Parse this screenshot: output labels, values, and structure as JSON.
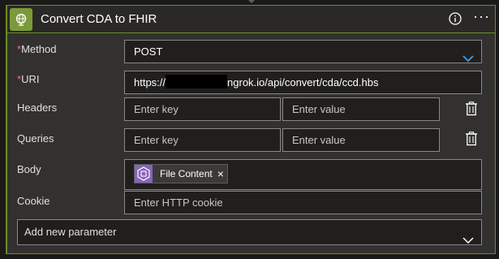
{
  "header": {
    "title": "Convert CDA to FHIR",
    "icon": "globe-icon",
    "info_icon": "info-icon",
    "more_label": "···"
  },
  "fields": {
    "method": {
      "label": "Method",
      "required_mark": "*",
      "value": "POST"
    },
    "uri": {
      "label": "URI",
      "required_mark": "*",
      "value_prefix": "https://",
      "value_suffix": "ngrok.io/api/convert/cda/ccd.hbs"
    },
    "headers": {
      "label": "Headers",
      "key_placeholder": "Enter key",
      "value_placeholder": "Enter value"
    },
    "queries": {
      "label": "Queries",
      "key_placeholder": "Enter key",
      "value_placeholder": "Enter value"
    },
    "body": {
      "label": "Body",
      "token_label": "File Content",
      "token_close": "×"
    },
    "cookie": {
      "label": "Cookie",
      "placeholder": "Enter HTTP cookie"
    }
  },
  "add_parameter": {
    "label": "Add new parameter"
  },
  "colors": {
    "accent": "#6b8e23",
    "required": "#f1707b",
    "chevron": "#3aa0f3",
    "token_icon": "#8764b8"
  }
}
